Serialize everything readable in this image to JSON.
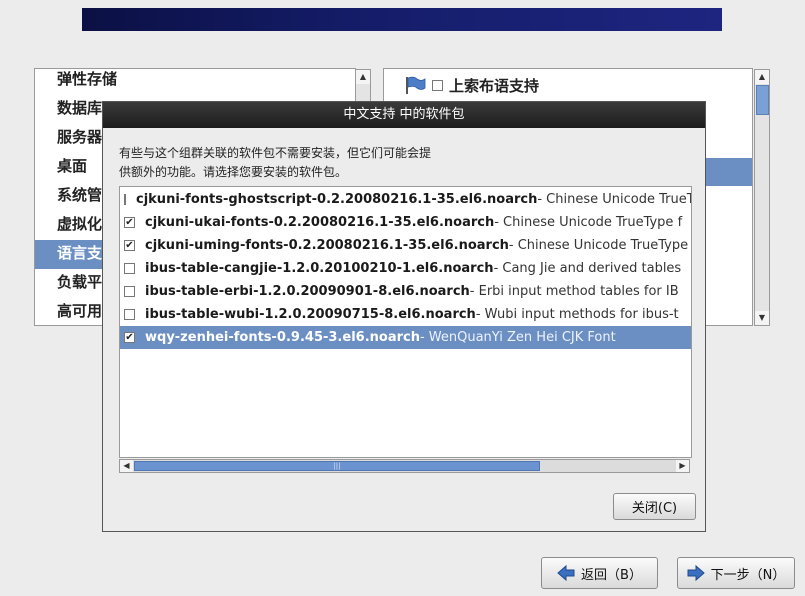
{
  "left_panel": {
    "groups": [
      "弹性存储",
      "数据库",
      "服务器",
      "桌面",
      "系统管理",
      "虚拟化",
      "语言支持",
      "负载平衡器",
      "高可用性"
    ],
    "selected_index": 6
  },
  "right_panel": {
    "item_label": "上索布语支持"
  },
  "dialog": {
    "title": "中文支持 中的软件包",
    "description_line1": "有些与这个组群关联的软件包不需要安装，但它们可能会提",
    "description_line2": "供额外的功能。请选择您要安装的软件包。",
    "packages": [
      {
        "name": "cjkuni-fonts-ghostscript-0.2.20080216.1-35.el6.noarch",
        "desc": " - Chinese Unicode TrueType",
        "checked": false
      },
      {
        "name": "cjkuni-ukai-fonts-0.2.20080216.1-35.el6.noarch",
        "desc": " - Chinese Unicode TrueType f",
        "checked": true
      },
      {
        "name": "cjkuni-uming-fonts-0.2.20080216.1-35.el6.noarch",
        "desc": " - Chinese Unicode TrueType",
        "checked": true
      },
      {
        "name": "ibus-table-cangjie-1.2.0.20100210-1.el6.noarch",
        "desc": " - Cang Jie and derived tables",
        "checked": false
      },
      {
        "name": "ibus-table-erbi-1.2.0.20090901-8.el6.noarch",
        "desc": " - Erbi input method tables for IB",
        "checked": false
      },
      {
        "name": "ibus-table-wubi-1.2.0.20090715-8.el6.noarch",
        "desc": " - Wubi input methods for ibus-t",
        "checked": false
      },
      {
        "name": "wqy-zenhei-fonts-0.9.45-3.el6.noarch",
        "desc": " - WenQuanYi Zen Hei CJK Font",
        "checked": true
      }
    ],
    "selected_package_index": 6,
    "close_label": "关闭(C)"
  },
  "footer": {
    "back_label": "返回（B）",
    "next_label": "下一步（N）"
  },
  "colors": {
    "selection": "#6b8fc3",
    "banner": "#151d6a",
    "dialog_title": "#1c1c1c"
  }
}
